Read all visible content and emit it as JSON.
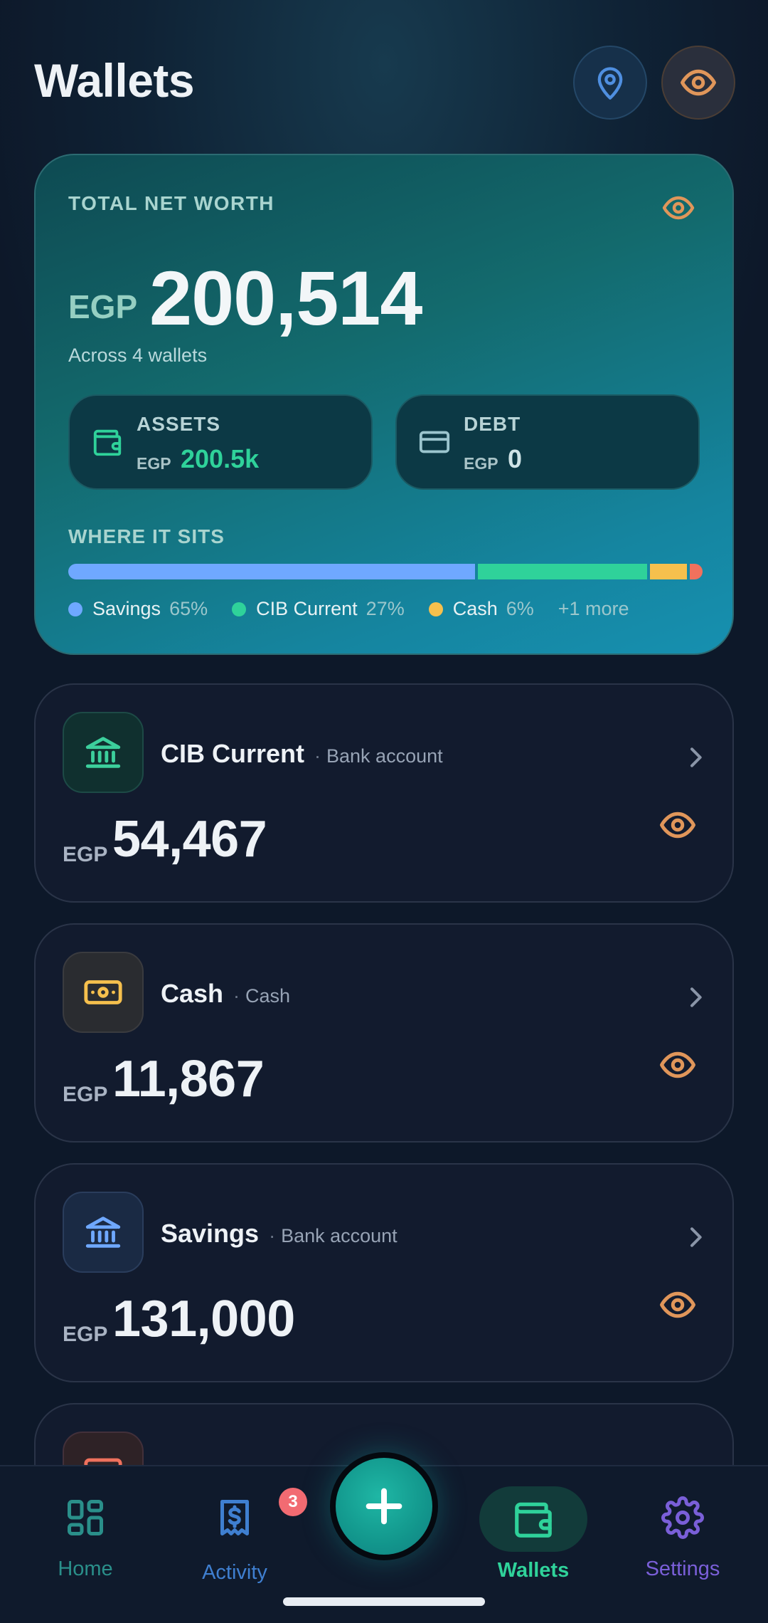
{
  "header": {
    "title": "Wallets"
  },
  "net_worth": {
    "label": "TOTAL NET WORTH",
    "currency": "EGP",
    "amount": "200,514",
    "subtitle": "Across 4 wallets",
    "assets": {
      "label": "ASSETS",
      "currency": "EGP",
      "value": "200.5k"
    },
    "debt": {
      "label": "DEBT",
      "currency": "EGP",
      "value": "0"
    },
    "where_label": "WHERE IT SITS",
    "breakdown": [
      {
        "name": "Savings",
        "percent": 65,
        "pct_label": "65%",
        "color": "#6fa8ff"
      },
      {
        "name": "CIB Current",
        "percent": 27,
        "pct_label": "27%",
        "color": "#2fd29a"
      },
      {
        "name": "Cash",
        "percent": 6,
        "pct_label": "6%",
        "color": "#f6c04d"
      },
      {
        "name": "",
        "percent": 2,
        "pct_label": "",
        "color": "#f0715d"
      }
    ],
    "more_label": "+1 more"
  },
  "wallets": [
    {
      "name": "CIB Current",
      "type": "Bank account",
      "currency": "EGP",
      "amount": "54,467",
      "icon": "bank-icon",
      "icon_color": "#3ccf9c",
      "icon_bg": "#10302f"
    },
    {
      "name": "Cash",
      "type": "Cash",
      "currency": "EGP",
      "amount": "11,867",
      "icon": "banknote-icon",
      "icon_color": "#f6c04d",
      "icon_bg": "#2a2c30"
    },
    {
      "name": "Savings",
      "type": "Bank account",
      "currency": "EGP",
      "amount": "131,000",
      "icon": "bank-icon",
      "icon_color": "#6fa8ff",
      "icon_bg": "#1a2a44"
    }
  ],
  "nav": {
    "home": "Home",
    "activity": "Activity",
    "activity_badge": "3",
    "wallets": "Wallets",
    "settings": "Settings"
  },
  "colors": {
    "accent_green": "#2fd29a",
    "eye_orange": "#e0965a",
    "location_blue": "#4f8fe0",
    "nav_home": "#2a8f8a",
    "nav_activity": "#3f7fd0",
    "nav_settings": "#7a5fd8"
  }
}
